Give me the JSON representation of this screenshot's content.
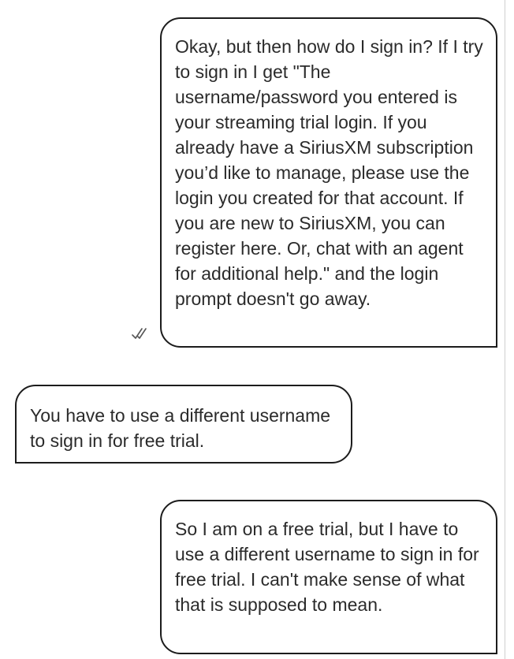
{
  "messages": [
    {
      "direction": "outgoing",
      "text": "Okay, but then how do I sign in? If I try to sign in I get \"The username/password you entered is your streaming trial login. If you already have a SiriusXM subscription you’d like to manage, please use the login you created for that account. If you are new to SiriusXM, you can register here. Or, chat with an agent for additional help.\" and the login prompt doesn't go away.",
      "status_icon": "double-check-icon"
    },
    {
      "direction": "incoming",
      "text": "You have to use a different username to sign in for free trial."
    },
    {
      "direction": "outgoing",
      "text": "So I am on a free trial, but I have to use a different username to sign in for free trial. I can't make sense of what that is supposed to mean."
    }
  ],
  "colors": {
    "bubble_border": "#1c1c1c",
    "text": "#2b2b2b",
    "receipt": "#555555",
    "divider": "#cfcfcf"
  }
}
